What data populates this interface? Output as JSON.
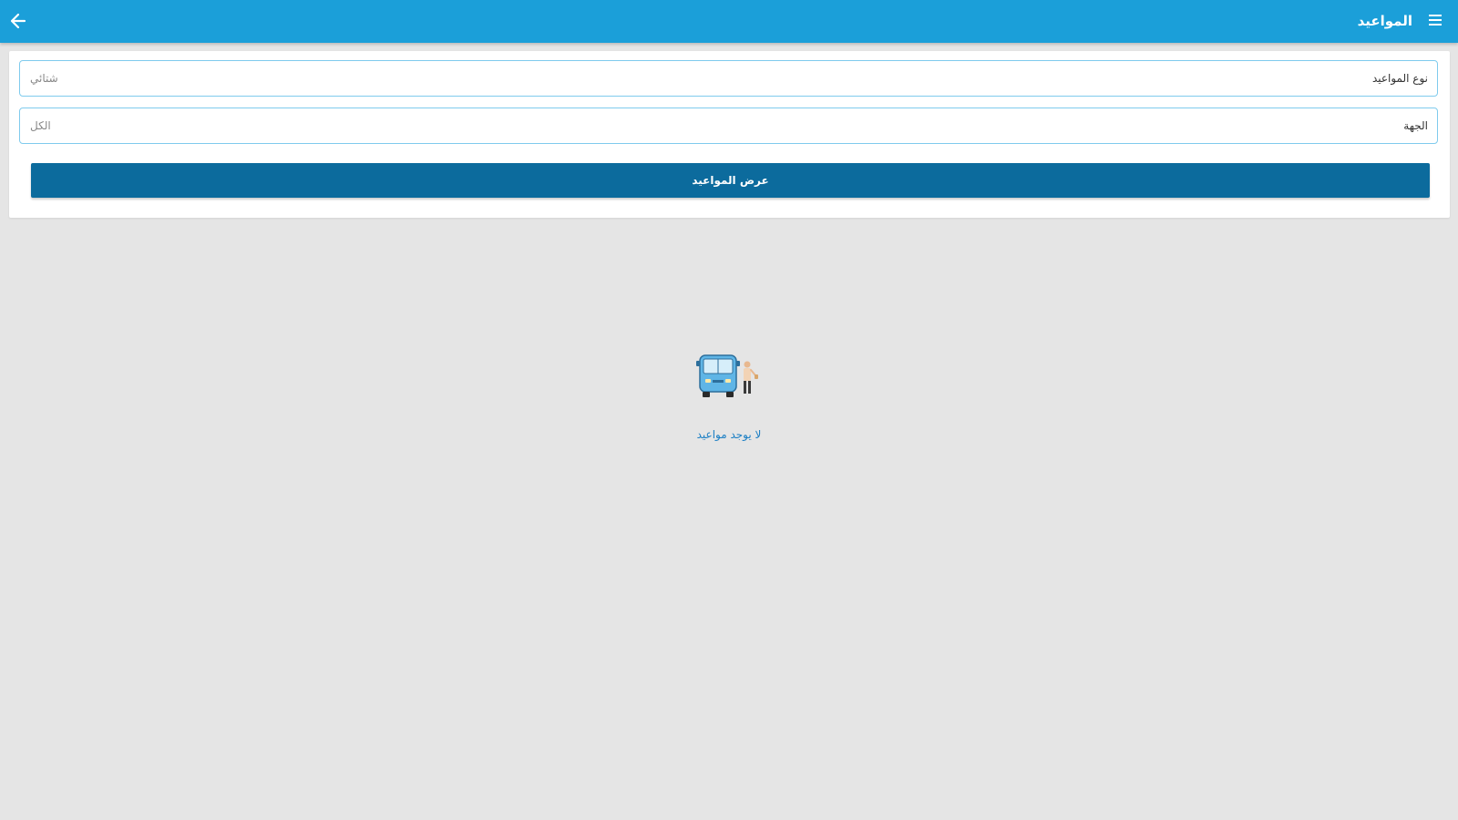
{
  "appbar": {
    "title": "المواعيد",
    "back_icon": "arrow-left-icon",
    "menu_icon": "menu-icon",
    "color": "#1b9fd9"
  },
  "form": {
    "schedule_type": {
      "label": "نوع المواعيد",
      "value": "شتائي"
    },
    "direction": {
      "label": "الجهة",
      "value": "الكل"
    },
    "show_button_label": "عرض المواعيد",
    "button_color": "#0c6b9d"
  },
  "empty_state": {
    "illustration": "bus-with-passenger-illustration",
    "message": "لا يوجد مواعيد"
  }
}
